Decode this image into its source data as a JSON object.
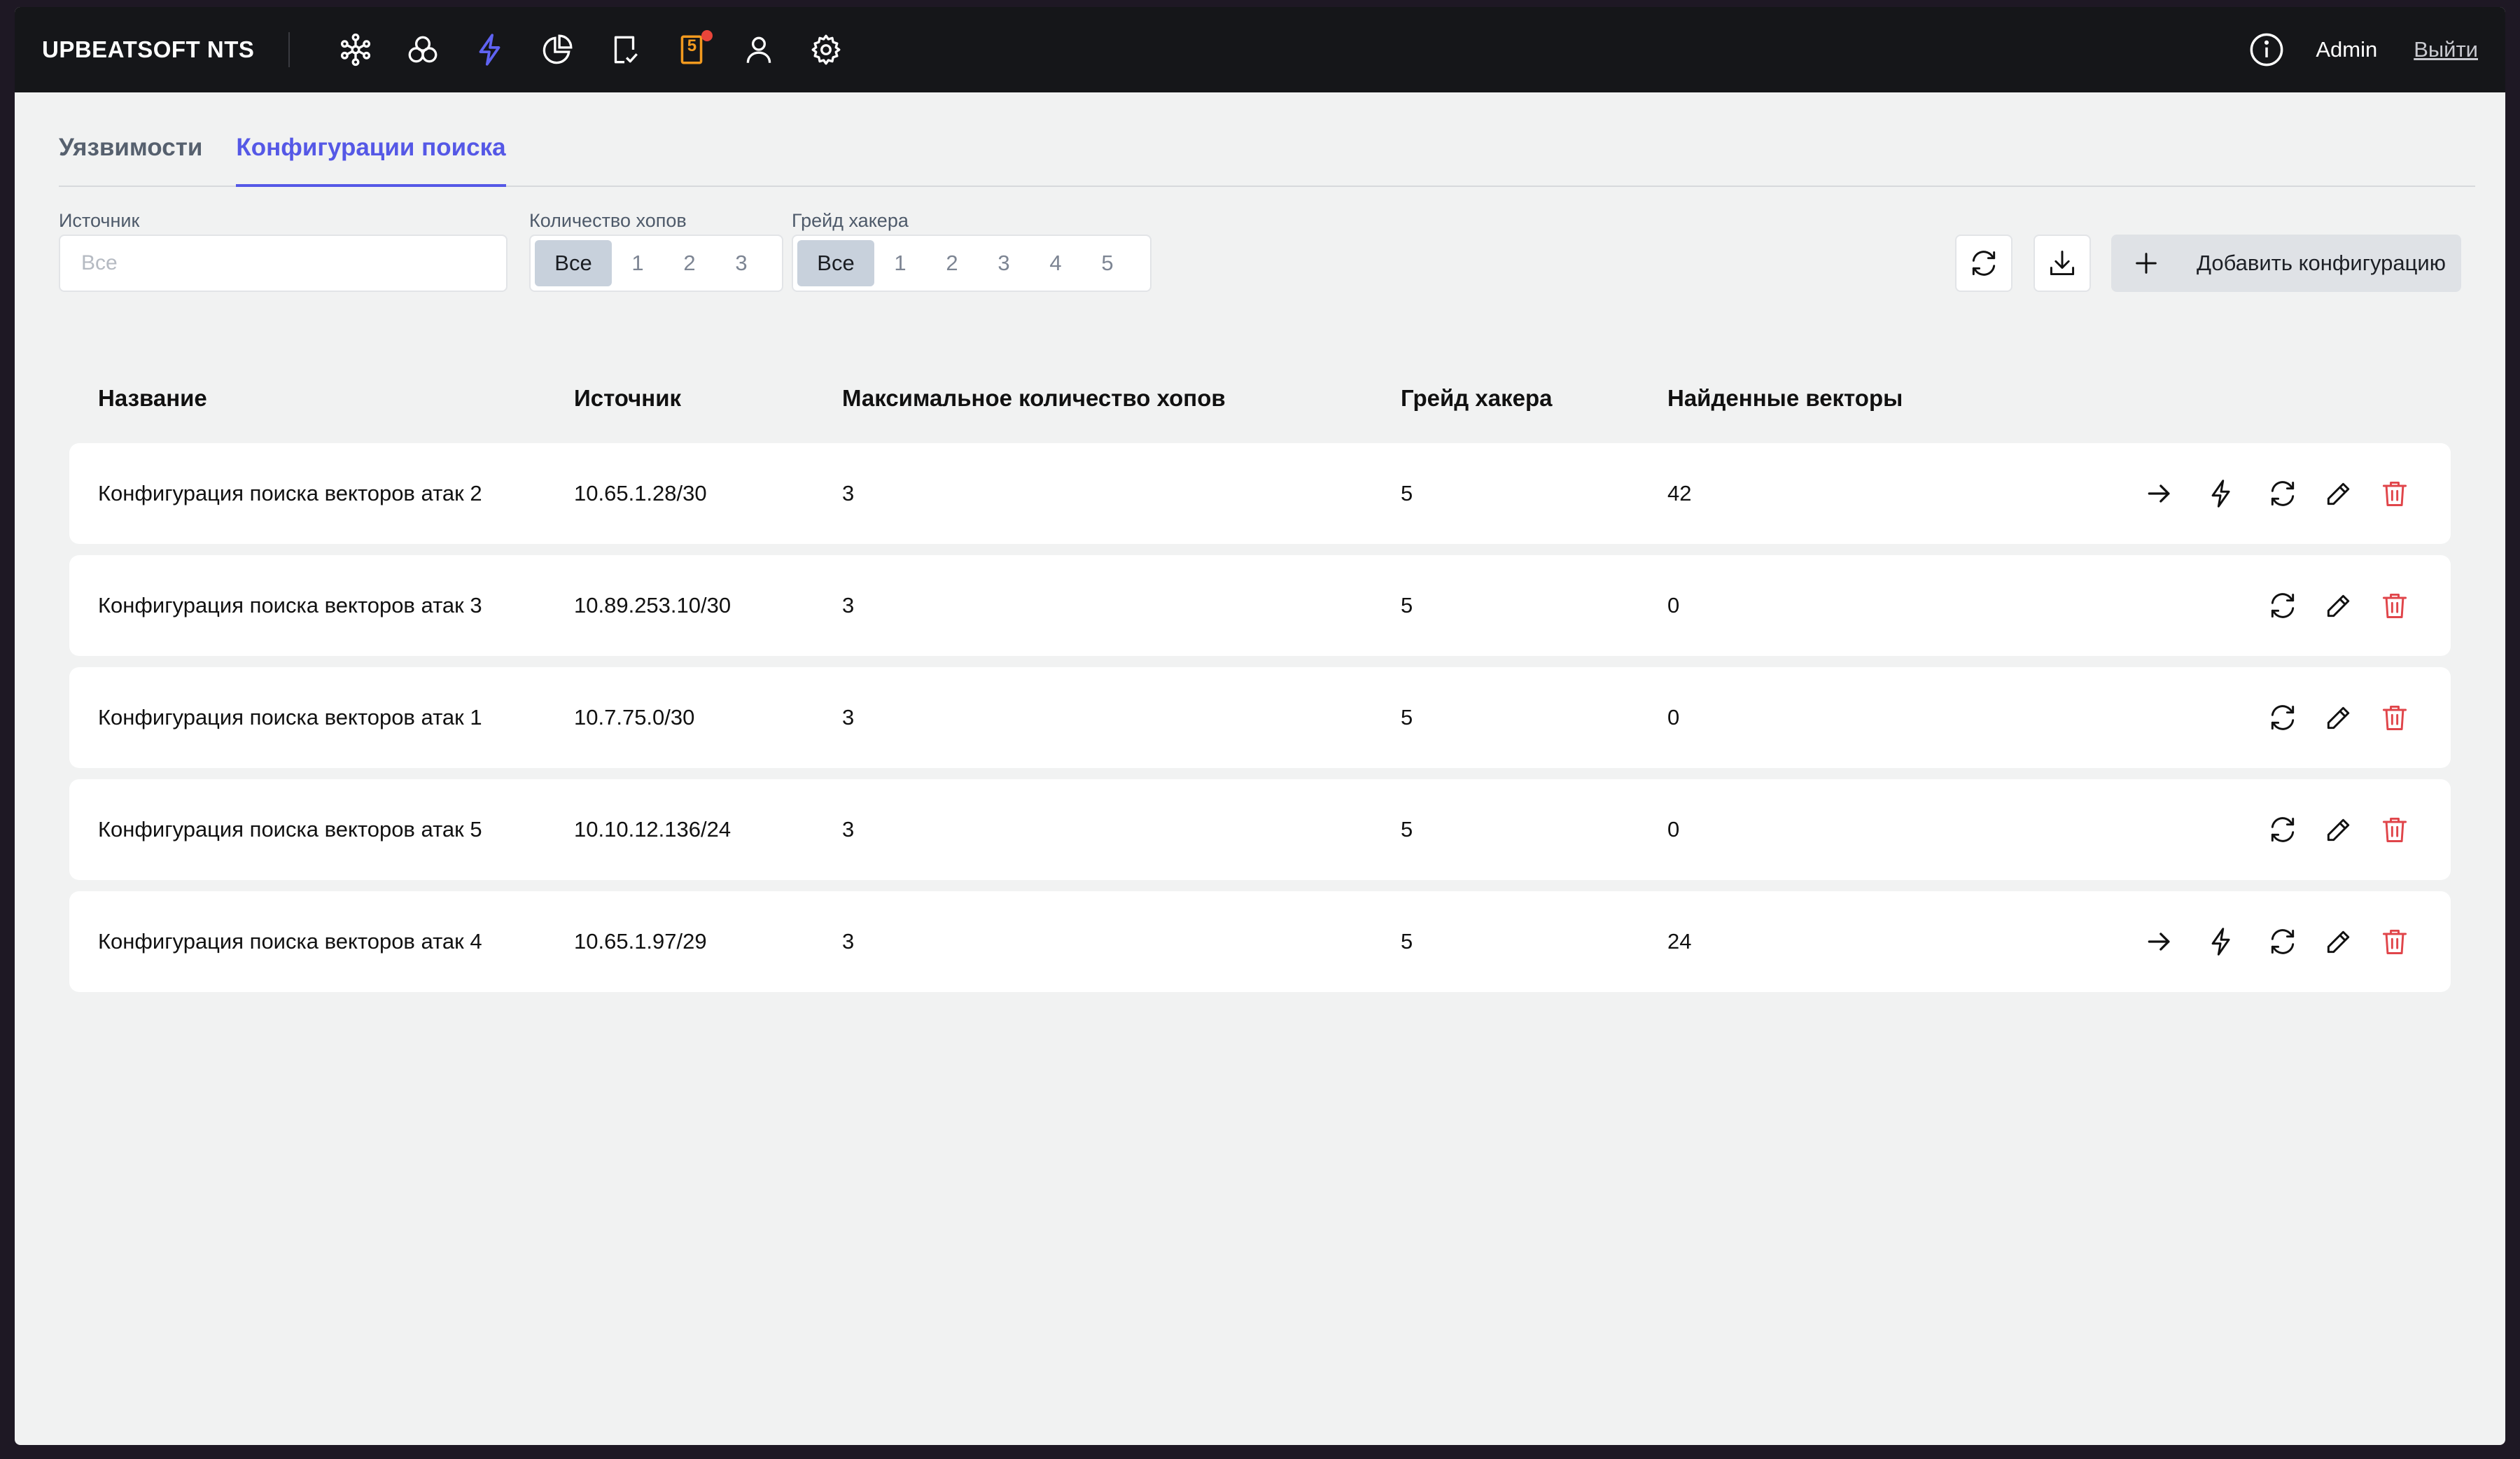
{
  "app": {
    "brand": "UPBEATSOFT NTS",
    "notification_count": "5",
    "user": "Admin",
    "logout": "Выйти"
  },
  "nav_icons": [
    "network-graph-icon",
    "circles-icon",
    "lightning-icon",
    "pie-chart-icon",
    "tasks-icon",
    "notifications-icon",
    "user-icon",
    "gear-icon"
  ],
  "tabs": [
    {
      "label": "Уязвимости",
      "active": false
    },
    {
      "label": "Конфигурации поиска",
      "active": true
    }
  ],
  "filters": {
    "source_label": "Источник",
    "source_placeholder": "Все",
    "hops_label": "Количество хопов",
    "hops_options": [
      "Все",
      "1",
      "2",
      "3"
    ],
    "hops_selected": "Все",
    "grade_label": "Грейд хакера",
    "grade_options": [
      "Все",
      "1",
      "2",
      "3",
      "4",
      "5"
    ],
    "grade_selected": "Все",
    "add_button": "Добавить конфигурацию"
  },
  "table": {
    "columns": [
      "Название",
      "Источник",
      "Максимальное количество хопов",
      "Грейд хакера",
      "Найденные векторы"
    ],
    "rows": [
      {
        "name": "Конфигурация поиска векторов атак 2",
        "source": "10.65.1.28/30",
        "max_hops": "3",
        "grade": "5",
        "vectors": "42",
        "has_results": true
      },
      {
        "name": "Конфигурация поиска векторов атак 3",
        "source": "10.89.253.10/30",
        "max_hops": "3",
        "grade": "5",
        "vectors": "0",
        "has_results": false
      },
      {
        "name": "Конфигурация поиска векторов атак 1",
        "source": "10.7.75.0/30",
        "max_hops": "3",
        "grade": "5",
        "vectors": "0",
        "has_results": false
      },
      {
        "name": "Конфигурация поиска векторов атак 5",
        "source": "10.10.12.136/24",
        "max_hops": "3",
        "grade": "5",
        "vectors": "0",
        "has_results": false
      },
      {
        "name": "Конфигурация поиска векторов атак 4",
        "source": "10.65.1.97/29",
        "max_hops": "3",
        "grade": "5",
        "vectors": "24",
        "has_results": true
      }
    ]
  },
  "colors": {
    "accent": "#5558e6",
    "topbar": "#151619",
    "delete": "#e0454a",
    "notification": "#f29a1f"
  }
}
